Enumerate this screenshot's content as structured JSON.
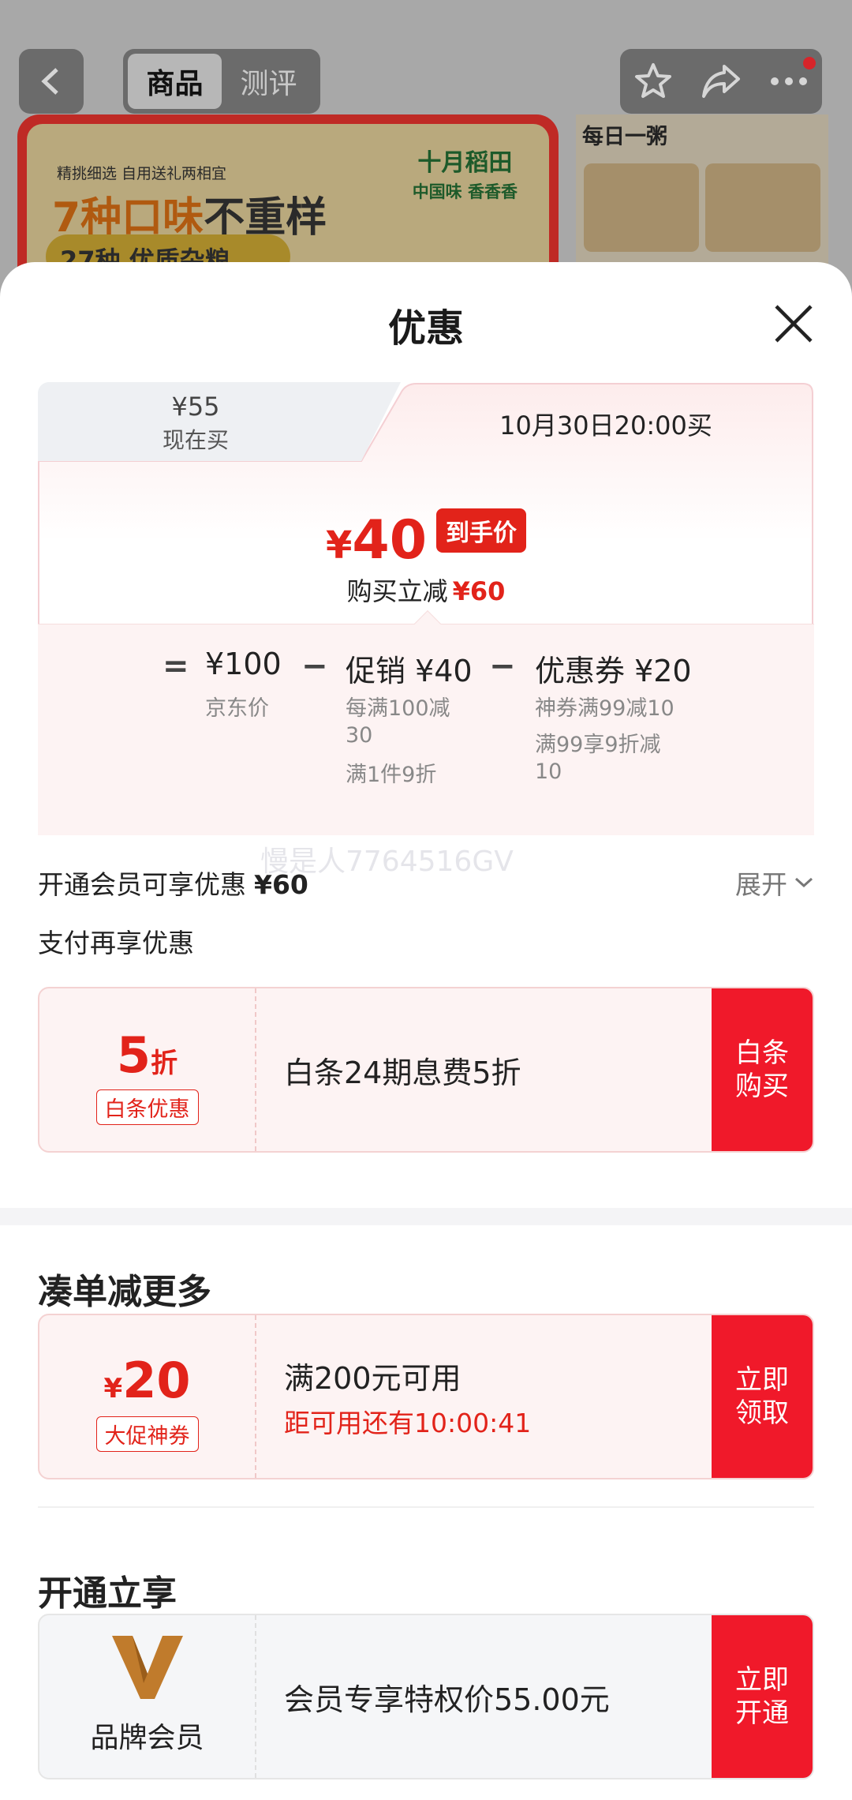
{
  "background": {
    "tabs": [
      {
        "label": "商品",
        "active": true
      },
      {
        "label": "测评",
        "active": false
      }
    ],
    "banner": {
      "line1": "精挑细选 自用送礼两相宜",
      "line2_highlight": "7种口味",
      "line2_rest": "不重样",
      "line3": "27种 优质杂粮",
      "logo_main": "十月稻田",
      "logo_sub": "中国味 香香香"
    },
    "side_title": "每日一粥",
    "colors": {
      "brand_red": "#e2231a"
    }
  },
  "sheet": {
    "title": "优惠",
    "price_card": {
      "tab_now_price": "¥55",
      "tab_now_label": "现在买",
      "tab_later_label": "10月30日20:00买",
      "final_currency": "¥",
      "final_price": "40",
      "final_tag": "到手价",
      "reduce_label": "购买立减",
      "reduce_amount": "¥60",
      "calc": {
        "equals": "=",
        "minus": "−",
        "jd_price": "¥100",
        "jd_label": "京东价",
        "promo": "促销 ¥40",
        "promo_detail1": "每满100减",
        "promo_detail1b": "30",
        "promo_detail2": "满1件9折",
        "coupon": "优惠券 ¥20",
        "coupon_detail1": "神券满99减10",
        "coupon_detail2": "满99享9折减",
        "coupon_detail2b": "10"
      }
    },
    "watermark": "慢是人7764516GV",
    "vip": {
      "label": "开通会员可享优惠",
      "amount": "¥60",
      "expand": "展开"
    },
    "pay_title": "支付再享优惠",
    "baitiao": {
      "big": "5",
      "unit": "折",
      "tag": "白条优惠",
      "desc": "白条24期息费5折",
      "btn1": "白条",
      "btn2": "购买"
    },
    "section_more": "凑单减更多",
    "coupon20": {
      "currency": "¥",
      "amount": "20",
      "tag": "大促神券",
      "desc": "满200元可用",
      "countdown": "距可用还有10:00:41",
      "btn1": "立即",
      "btn2": "领取"
    },
    "section_open": "开通立享",
    "member": {
      "brand_label": "品牌会员",
      "desc": "会员专享特权价55.00元",
      "btn1": "立即",
      "btn2": "开通"
    }
  }
}
